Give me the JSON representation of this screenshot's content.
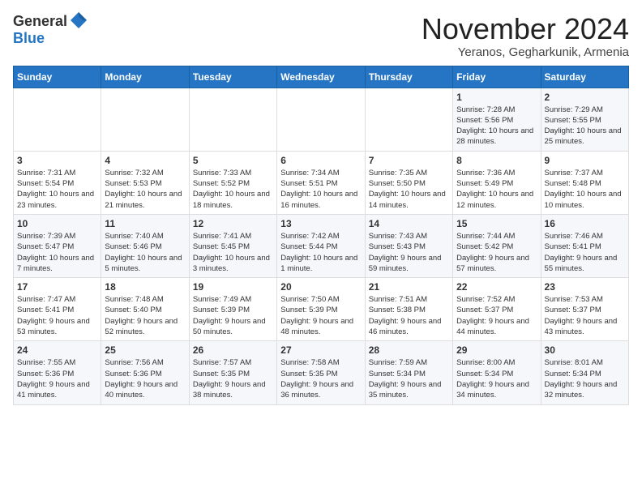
{
  "header": {
    "logo_general": "General",
    "logo_blue": "Blue",
    "month_title": "November 2024",
    "location": "Yeranos, Gegharkunik, Armenia"
  },
  "calendar": {
    "days_of_week": [
      "Sunday",
      "Monday",
      "Tuesday",
      "Wednesday",
      "Thursday",
      "Friday",
      "Saturday"
    ],
    "weeks": [
      [
        {
          "day": "",
          "info": ""
        },
        {
          "day": "",
          "info": ""
        },
        {
          "day": "",
          "info": ""
        },
        {
          "day": "",
          "info": ""
        },
        {
          "day": "",
          "info": ""
        },
        {
          "day": "1",
          "info": "Sunrise: 7:28 AM\nSunset: 5:56 PM\nDaylight: 10 hours and 28 minutes."
        },
        {
          "day": "2",
          "info": "Sunrise: 7:29 AM\nSunset: 5:55 PM\nDaylight: 10 hours and 25 minutes."
        }
      ],
      [
        {
          "day": "3",
          "info": "Sunrise: 7:31 AM\nSunset: 5:54 PM\nDaylight: 10 hours and 23 minutes."
        },
        {
          "day": "4",
          "info": "Sunrise: 7:32 AM\nSunset: 5:53 PM\nDaylight: 10 hours and 21 minutes."
        },
        {
          "day": "5",
          "info": "Sunrise: 7:33 AM\nSunset: 5:52 PM\nDaylight: 10 hours and 18 minutes."
        },
        {
          "day": "6",
          "info": "Sunrise: 7:34 AM\nSunset: 5:51 PM\nDaylight: 10 hours and 16 minutes."
        },
        {
          "day": "7",
          "info": "Sunrise: 7:35 AM\nSunset: 5:50 PM\nDaylight: 10 hours and 14 minutes."
        },
        {
          "day": "8",
          "info": "Sunrise: 7:36 AM\nSunset: 5:49 PM\nDaylight: 10 hours and 12 minutes."
        },
        {
          "day": "9",
          "info": "Sunrise: 7:37 AM\nSunset: 5:48 PM\nDaylight: 10 hours and 10 minutes."
        }
      ],
      [
        {
          "day": "10",
          "info": "Sunrise: 7:39 AM\nSunset: 5:47 PM\nDaylight: 10 hours and 7 minutes."
        },
        {
          "day": "11",
          "info": "Sunrise: 7:40 AM\nSunset: 5:46 PM\nDaylight: 10 hours and 5 minutes."
        },
        {
          "day": "12",
          "info": "Sunrise: 7:41 AM\nSunset: 5:45 PM\nDaylight: 10 hours and 3 minutes."
        },
        {
          "day": "13",
          "info": "Sunrise: 7:42 AM\nSunset: 5:44 PM\nDaylight: 10 hours and 1 minute."
        },
        {
          "day": "14",
          "info": "Sunrise: 7:43 AM\nSunset: 5:43 PM\nDaylight: 9 hours and 59 minutes."
        },
        {
          "day": "15",
          "info": "Sunrise: 7:44 AM\nSunset: 5:42 PM\nDaylight: 9 hours and 57 minutes."
        },
        {
          "day": "16",
          "info": "Sunrise: 7:46 AM\nSunset: 5:41 PM\nDaylight: 9 hours and 55 minutes."
        }
      ],
      [
        {
          "day": "17",
          "info": "Sunrise: 7:47 AM\nSunset: 5:41 PM\nDaylight: 9 hours and 53 minutes."
        },
        {
          "day": "18",
          "info": "Sunrise: 7:48 AM\nSunset: 5:40 PM\nDaylight: 9 hours and 52 minutes."
        },
        {
          "day": "19",
          "info": "Sunrise: 7:49 AM\nSunset: 5:39 PM\nDaylight: 9 hours and 50 minutes."
        },
        {
          "day": "20",
          "info": "Sunrise: 7:50 AM\nSunset: 5:39 PM\nDaylight: 9 hours and 48 minutes."
        },
        {
          "day": "21",
          "info": "Sunrise: 7:51 AM\nSunset: 5:38 PM\nDaylight: 9 hours and 46 minutes."
        },
        {
          "day": "22",
          "info": "Sunrise: 7:52 AM\nSunset: 5:37 PM\nDaylight: 9 hours and 44 minutes."
        },
        {
          "day": "23",
          "info": "Sunrise: 7:53 AM\nSunset: 5:37 PM\nDaylight: 9 hours and 43 minutes."
        }
      ],
      [
        {
          "day": "24",
          "info": "Sunrise: 7:55 AM\nSunset: 5:36 PM\nDaylight: 9 hours and 41 minutes."
        },
        {
          "day": "25",
          "info": "Sunrise: 7:56 AM\nSunset: 5:36 PM\nDaylight: 9 hours and 40 minutes."
        },
        {
          "day": "26",
          "info": "Sunrise: 7:57 AM\nSunset: 5:35 PM\nDaylight: 9 hours and 38 minutes."
        },
        {
          "day": "27",
          "info": "Sunrise: 7:58 AM\nSunset: 5:35 PM\nDaylight: 9 hours and 36 minutes."
        },
        {
          "day": "28",
          "info": "Sunrise: 7:59 AM\nSunset: 5:34 PM\nDaylight: 9 hours and 35 minutes."
        },
        {
          "day": "29",
          "info": "Sunrise: 8:00 AM\nSunset: 5:34 PM\nDaylight: 9 hours and 34 minutes."
        },
        {
          "day": "30",
          "info": "Sunrise: 8:01 AM\nSunset: 5:34 PM\nDaylight: 9 hours and 32 minutes."
        }
      ]
    ]
  }
}
